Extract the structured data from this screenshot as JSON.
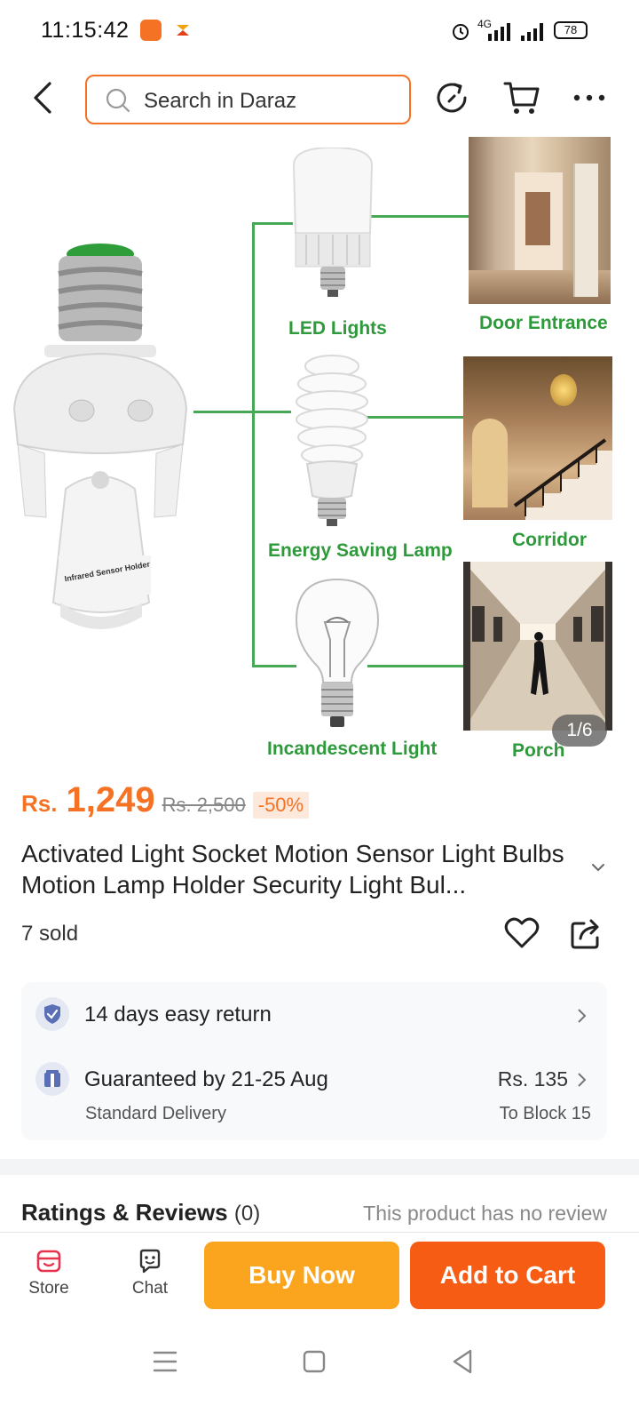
{
  "status_bar": {
    "time": "11:15:42",
    "network": "4G",
    "battery": "78"
  },
  "header": {
    "search_placeholder": "Search in Daraz"
  },
  "gallery": {
    "labels": {
      "led": "LED Lights",
      "door": "Door Entrance",
      "energy": "Energy Saving Lamp",
      "corridor": "Corridor",
      "incandescent": "Incandescent Light",
      "porch": "Porch"
    },
    "socket_label": "Infrared Sensor Holder",
    "page_indicator": "1/6"
  },
  "product": {
    "currency": "Rs.",
    "price": "1,249",
    "original_price": "Rs. 2,500",
    "discount": "-50%",
    "title": "Activated Light Socket Motion Sensor Light Bulbs Motion Lamp Holder Security Light Bul...",
    "sold": "7 sold"
  },
  "service": {
    "return_text": "14 days easy return",
    "delivery_text": "Guaranteed by 21-25 Aug",
    "delivery_type": "Standard Delivery",
    "shipping_price": "Rs. 135",
    "ship_to": "To Block 15"
  },
  "reviews": {
    "title": "Ratings & Reviews",
    "count": "(0)",
    "empty_text": "This product has no review"
  },
  "bottom_bar": {
    "store_label": "Store",
    "chat_label": "Chat",
    "buy_now": "Buy Now",
    "add_to_cart": "Add to Cart"
  },
  "colors": {
    "brand": "#f57224",
    "buy_now": "#fba51e",
    "add_to_cart": "#f75c15",
    "gallery_green": "#2e9a3b"
  }
}
